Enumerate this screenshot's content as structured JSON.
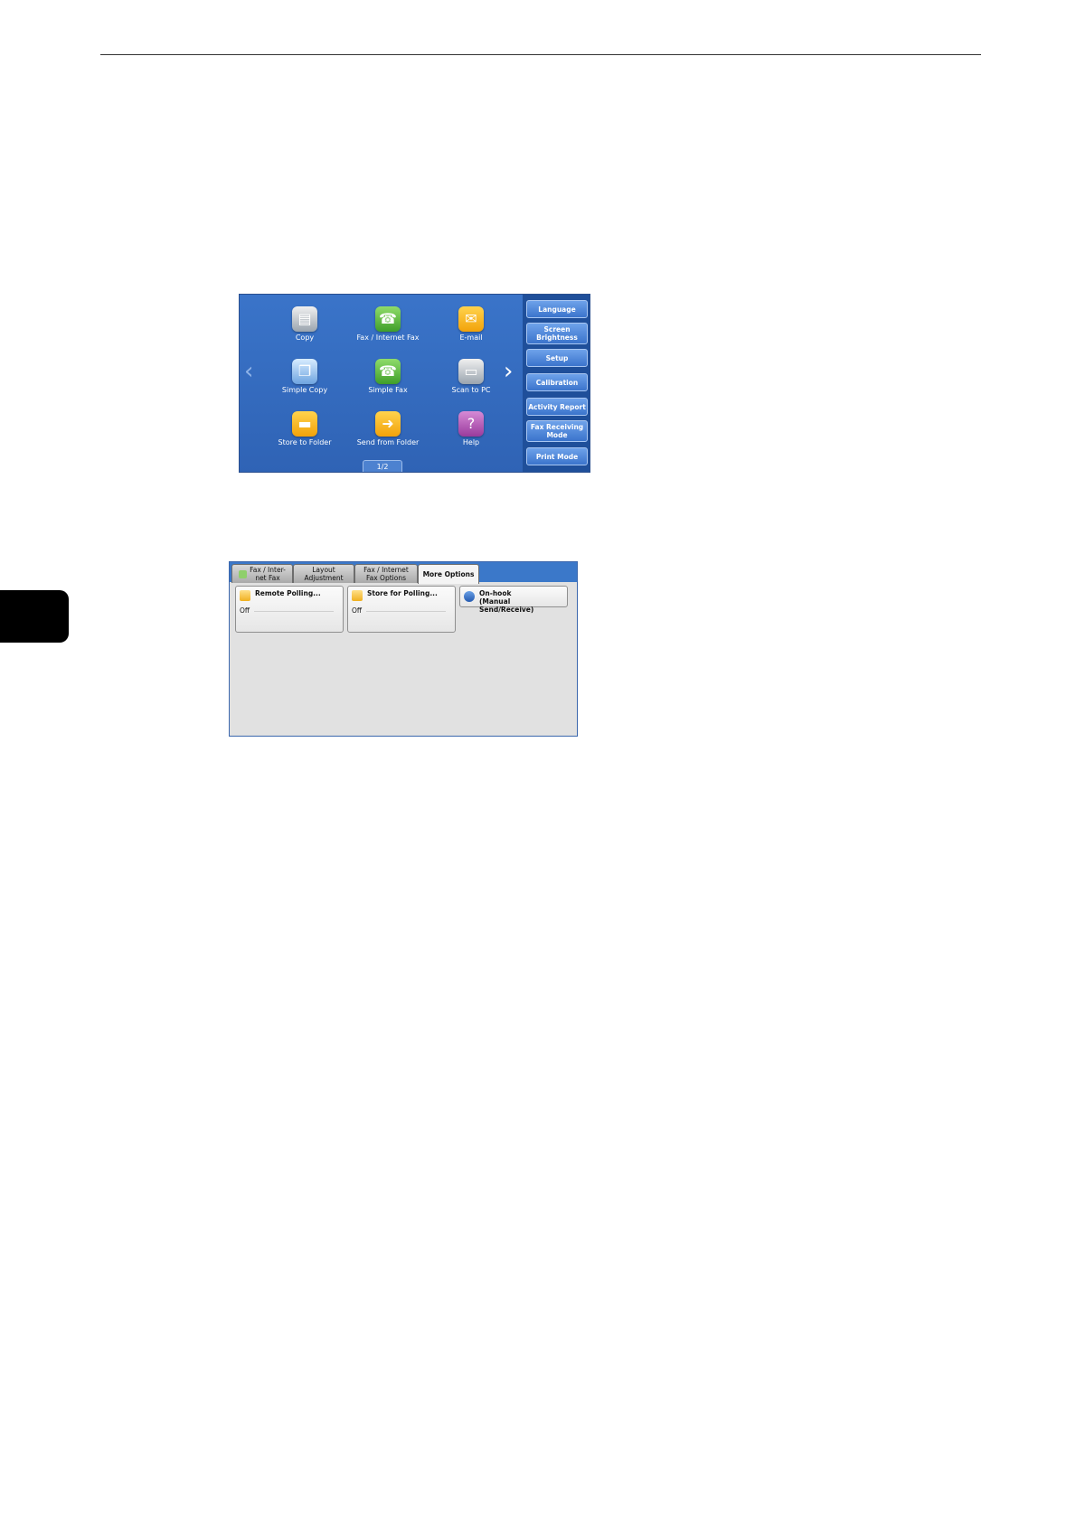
{
  "home_screen": {
    "apps": [
      {
        "label": "Copy",
        "icon": "copy-icon",
        "color": "gray"
      },
      {
        "label": "Fax / Internet Fax",
        "icon": "fax-icon",
        "color": "green"
      },
      {
        "label": "E-mail",
        "icon": "email-icon",
        "color": "orange"
      },
      {
        "label": "Simple Copy",
        "icon": "simple-copy-icon",
        "color": "blue"
      },
      {
        "label": "Simple Fax",
        "icon": "simple-fax-icon",
        "color": "green"
      },
      {
        "label": "Scan to PC",
        "icon": "scan-to-pc-icon",
        "color": "gray"
      },
      {
        "label": "Store to Folder",
        "icon": "folder-icon",
        "color": "orange"
      },
      {
        "label": "Send from Folder",
        "icon": "send-from-folder-icon",
        "color": "orange"
      },
      {
        "label": "Help",
        "icon": "help-icon",
        "color": "purple"
      }
    ],
    "pager": "1/2",
    "side_buttons": [
      "Language",
      "Screen Brightness",
      "Setup",
      "Calibration",
      "Activity Report",
      "Fax Receiving Mode",
      "Print Mode"
    ]
  },
  "fax_screen": {
    "tabs": [
      {
        "label": "Fax / Inter-net Fax",
        "line1": "Fax / Inter-",
        "line2": "net Fax"
      },
      {
        "label": "Layout Adjustment",
        "line1": "Layout",
        "line2": "Adjustment"
      },
      {
        "label": "Fax / Internet Fax Options",
        "line1": "Fax / Internet",
        "line2": "Fax Options"
      },
      {
        "label": "More Options",
        "line1": "More Options",
        "line2": ""
      }
    ],
    "active_tab": "More Options",
    "options": [
      {
        "title": "Remote Polling...",
        "value": "Off"
      },
      {
        "title": "Store for Polling...",
        "value": "Off"
      },
      {
        "title_line1": "On-hook",
        "title_line2": "(Manual Send/Receive)"
      }
    ]
  },
  "colors": {
    "home_background": "#3a74c9",
    "side_panel": "#1f4f9a",
    "tab_bar": "#3b78c9",
    "panel_gray": "#e1e1e1"
  }
}
